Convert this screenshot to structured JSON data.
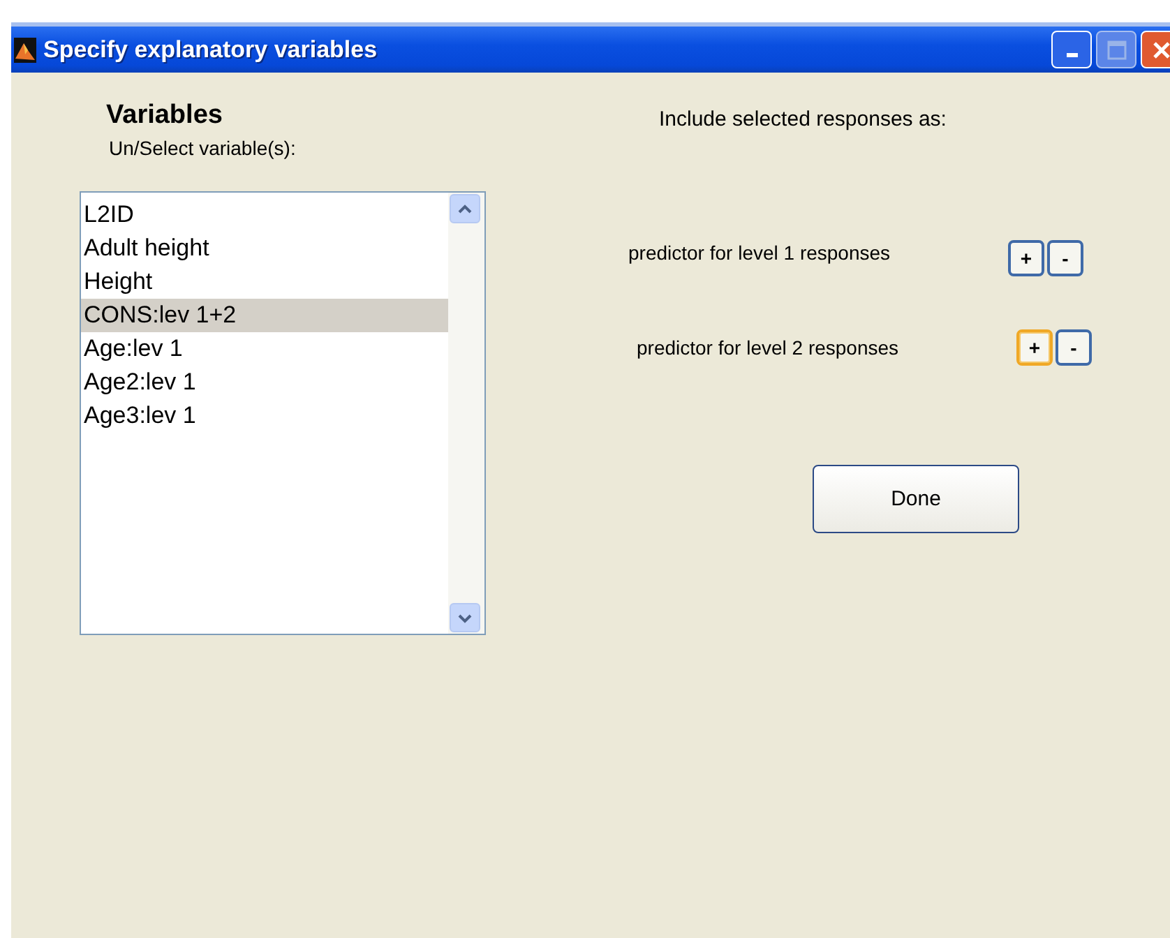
{
  "window": {
    "title": "Specify explanatory variables"
  },
  "variables": {
    "heading": "Variables",
    "subtitle": "Un/Select variable(s):",
    "items": [
      {
        "label": "L2ID",
        "selected": false
      },
      {
        "label": "Adult height",
        "selected": false
      },
      {
        "label": "Height",
        "selected": false
      },
      {
        "label": "CONS:lev 1+2",
        "selected": true
      },
      {
        "label": "Age:lev 1",
        "selected": false
      },
      {
        "label": "Age2:lev 1",
        "selected": false
      },
      {
        "label": "Age3:lev 1",
        "selected": false
      }
    ]
  },
  "include": {
    "heading": "Include selected responses as:",
    "rows": [
      {
        "label": "predictor for level 1 responses",
        "buttons": [
          {
            "label": "+",
            "focused": false
          },
          {
            "label": "-",
            "focused": false
          }
        ]
      },
      {
        "label": "predictor for level 2 responses",
        "buttons": [
          {
            "label": "+",
            "focused": true
          },
          {
            "label": "-",
            "focused": false
          }
        ]
      }
    ]
  },
  "done_button": "Done"
}
